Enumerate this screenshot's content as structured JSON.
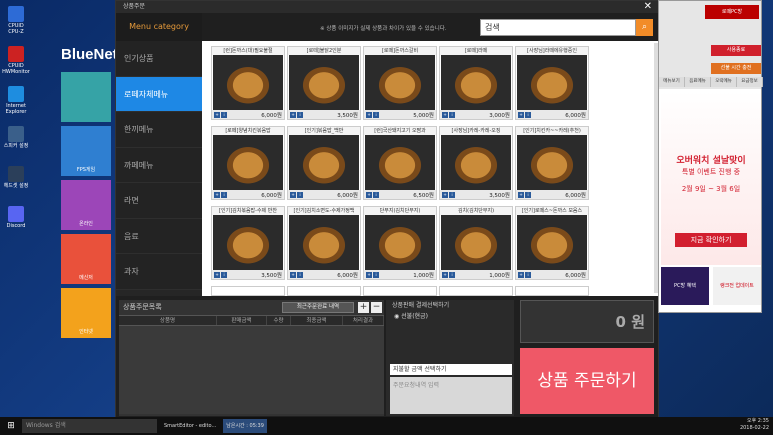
{
  "desktop": {
    "icons": [
      {
        "label": "CPUID CPU-Z",
        "color": "#2d6bd6",
        "icon": "cpu-icon"
      },
      {
        "label": "CPUID HWMonitor",
        "color": "#c22",
        "icon": "monitor-icon"
      },
      {
        "label": "Internet Explorer",
        "color": "#1e8de0",
        "icon": "ie-icon"
      },
      {
        "label": "스피커 설정",
        "color": "#3a5f8a",
        "icon": "settings-icon"
      },
      {
        "label": "헤드셋 설정",
        "color": "#2b3f5a",
        "icon": "headset-icon"
      },
      {
        "label": "Discord",
        "color": "#5865f2",
        "icon": "discord-icon"
      }
    ],
    "brand": "BlueNet",
    "tiles": [
      {
        "label": "",
        "color": "#36a3a6"
      },
      {
        "label": "FPS게임",
        "color": "#2f7fd1"
      },
      {
        "label": "온라인",
        "color": "#9c46b8"
      },
      {
        "label": "메신저",
        "color": "#e9513b"
      },
      {
        "label": "인터넷",
        "color": "#f3a21c"
      }
    ]
  },
  "window": {
    "title": "상품주문",
    "sidebar": {
      "heading": "Menu category",
      "items": [
        "인기상품",
        "로떼자체메뉴",
        "한끼메뉴",
        "까페메뉴",
        "라면",
        "음료",
        "과자"
      ],
      "active_index": 1
    },
    "notice": "※ 상품 이미지가 실제 상품과 차이가 있을 수 있습니다.",
    "search": {
      "placeholder": "검색",
      "value": "검색"
    },
    "products": [
      {
        "name": "[런]돈까스(대)필요불절",
        "price": "6,000원"
      },
      {
        "name": "[로떼]불닭2인분",
        "price": "3,500원"
      },
      {
        "name": "[로떼]돈까스갈비",
        "price": "5,000원"
      },
      {
        "name": "[로떼]라떼",
        "price": "3,000원"
      },
      {
        "name": "[사장님]라떼에유행중인",
        "price": "6,000원"
      },
      {
        "name": "[로떼]양념치킨볶음밥",
        "price": "6,000원"
      },
      {
        "name": "[인기]볶음밥_백반",
        "price": "6,000원"
      },
      {
        "name": "[런]국산돼지고기 오짬과",
        "price": "6,500원"
      },
      {
        "name": "[사장님]카레-카레-오징",
        "price": "3,500원"
      },
      {
        "name": "[인기]치킨카~~카레(추천)",
        "price": "6,000원"
      },
      {
        "name": "[인기]김치볶음밥-수제 반찬",
        "price": "3,500원"
      },
      {
        "name": "[인기]김치소면도-수제가정백",
        "price": "6,000원"
      },
      {
        "name": "단무지(김치단무지)",
        "price": "1,000원"
      },
      {
        "name": "김치(김치단무지)",
        "price": "1,000원"
      },
      {
        "name": "[인기]로떼스~돈까스 모음스",
        "price": "6,000원"
      }
    ],
    "orders": {
      "title": "상품주문목록",
      "recent_button": "최근주문완료 내역",
      "plus": "+",
      "minus": "−",
      "columns": [
        "상품명",
        "판매금액",
        "수량",
        "최종금액",
        "처리결과"
      ]
    },
    "payment": {
      "title": "상품판매 결제선택하기",
      "option": "선불(현금)",
      "select_placeholder": "지불할 금액 선택하기",
      "memo_placeholder": "주문요청내역 입력"
    },
    "total": "0 원",
    "order_button": "상품 주문하기"
  },
  "rpanel": {
    "brand": "로떼PC방",
    "btn_red": "사용종료",
    "btn_orange": "선불 시간 충전",
    "tabs": [
      "메뉴보기",
      "음료메뉴",
      "오락메뉴",
      "요금정보"
    ],
    "banner_title": "오버워치 설날맞이",
    "banner_sub": "특별 이벤트 진행 중",
    "banner_date": "2월 9일 ~ 3월 6일",
    "banner_cta": "지금 확인하기",
    "bottom_left": "PC방 혜택",
    "bottom_right": "랭크전 업데이트"
  },
  "taskbar": {
    "search": "Windows 검색",
    "items": [
      "SmartEditor - edito...",
      "남은시간 : 05:39"
    ],
    "time": "오후 2:35",
    "date": "2018-02-22"
  }
}
